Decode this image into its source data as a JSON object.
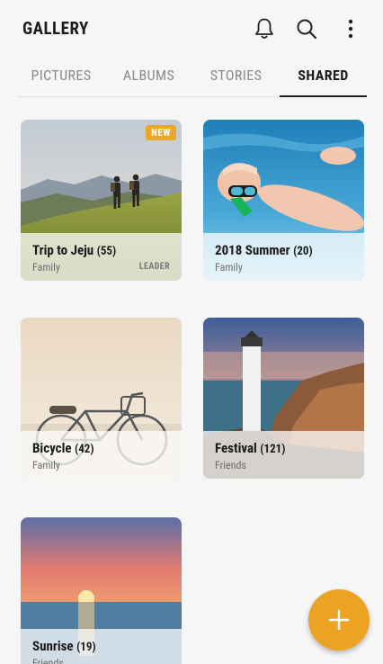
{
  "app": {
    "title": "GALLERY"
  },
  "tabs": [
    {
      "label": "PICTURES",
      "active": false
    },
    {
      "label": "ALBUMS",
      "active": false
    },
    {
      "label": "STORIES",
      "active": false
    },
    {
      "label": "SHARED",
      "active": true
    }
  ],
  "cards": [
    {
      "title": "Trip to Jeju",
      "count": "(55)",
      "subtitle": "Family",
      "badge": "NEW",
      "role": "LEADER"
    },
    {
      "title": "2018 Summer",
      "count": "(20)",
      "subtitle": "Family"
    },
    {
      "title": "Bicycle",
      "count": "(42)",
      "subtitle": "Family"
    },
    {
      "title": "Festival",
      "count": "(121)",
      "subtitle": "Friends"
    },
    {
      "title": "Sunrise",
      "count": "(19)",
      "subtitle": "Friends"
    }
  ],
  "icons": {
    "notifications": "bell-icon",
    "search": "search-icon",
    "more": "more-vertical-icon",
    "fab": "plus-icon"
  },
  "colors": {
    "accent": "#eca323",
    "badge": "#eaa72a"
  }
}
